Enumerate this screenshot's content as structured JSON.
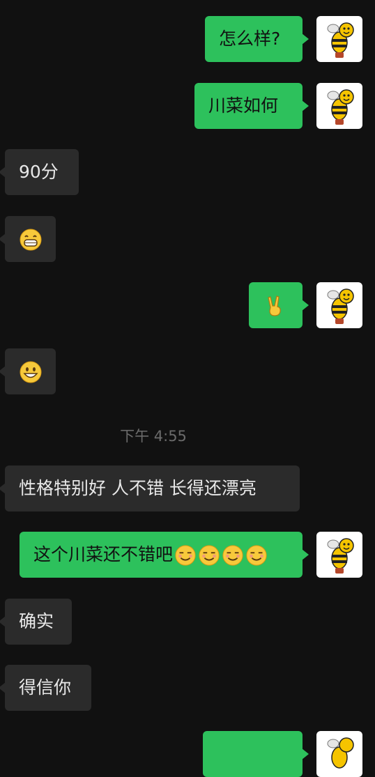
{
  "messages": [
    {
      "id": "m1",
      "side": "out",
      "text": "怎么样?"
    },
    {
      "id": "m2",
      "side": "out",
      "text": "川菜如何"
    },
    {
      "id": "m3",
      "side": "in",
      "text": "90分"
    },
    {
      "id": "m4",
      "side": "in",
      "emoji": "grinning-face-icon"
    },
    {
      "id": "m5",
      "side": "out",
      "emoji": "victory-hand-icon"
    },
    {
      "id": "m6",
      "side": "in",
      "emoji": "smiling-face-icon"
    },
    {
      "id": "m7",
      "side": "in",
      "text": "性格特别好 人不错 长得还漂亮"
    },
    {
      "id": "m8",
      "side": "out",
      "text": "这个川菜还不错吧",
      "emojis": [
        "smug-face-icon",
        "smug-face-icon",
        "smug-face-icon",
        "smug-face-icon"
      ]
    },
    {
      "id": "m9",
      "side": "in",
      "text": "确实"
    },
    {
      "id": "m10",
      "side": "in",
      "text": "得信你"
    }
  ],
  "timestamp": "下午 4:55",
  "avatar": {
    "name": "bee-avatar-icon"
  },
  "colors": {
    "background": "#111111",
    "outgoing": "#2dc15c",
    "incoming": "#2b2b2b",
    "timestamp": "#6b6b6b"
  }
}
